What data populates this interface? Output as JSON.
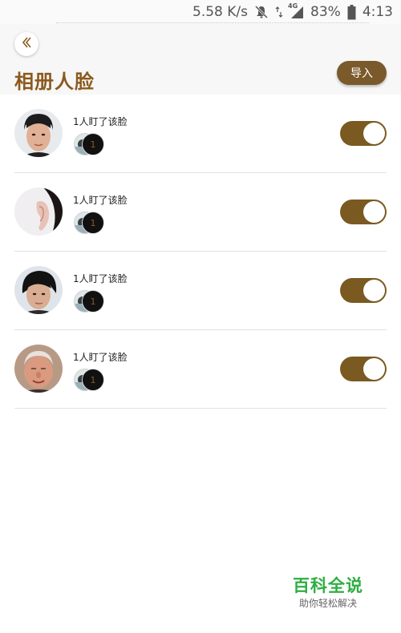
{
  "status_bar": {
    "speed": "5.58 K/s",
    "network": "4G",
    "battery": "83%",
    "time": "4:13",
    "icons": [
      "mute-bell-icon",
      "data-arrows-icon",
      "signal-icon",
      "battery-icon"
    ]
  },
  "header": {
    "back_icon": "chevron-left-icon",
    "title": "相册人脸",
    "import_label": "导入"
  },
  "faces": [
    {
      "label": "1人盯了该脸",
      "count": "1",
      "enabled": true,
      "avatar": "face-1"
    },
    {
      "label": "1人盯了该脸",
      "count": "1",
      "enabled": true,
      "avatar": "face-2"
    },
    {
      "label": "1人盯了该脸",
      "count": "1",
      "enabled": true,
      "avatar": "face-3"
    },
    {
      "label": "1人盯了该脸",
      "count": "1",
      "enabled": true,
      "avatar": "face-4"
    }
  ],
  "watermark": {
    "title": "百科全说",
    "subtitle": "助你轻松解决"
  },
  "colors": {
    "accent": "#8b5a1e",
    "toggle_on": "#7a5a20",
    "watermark_green": "#2eae42"
  }
}
